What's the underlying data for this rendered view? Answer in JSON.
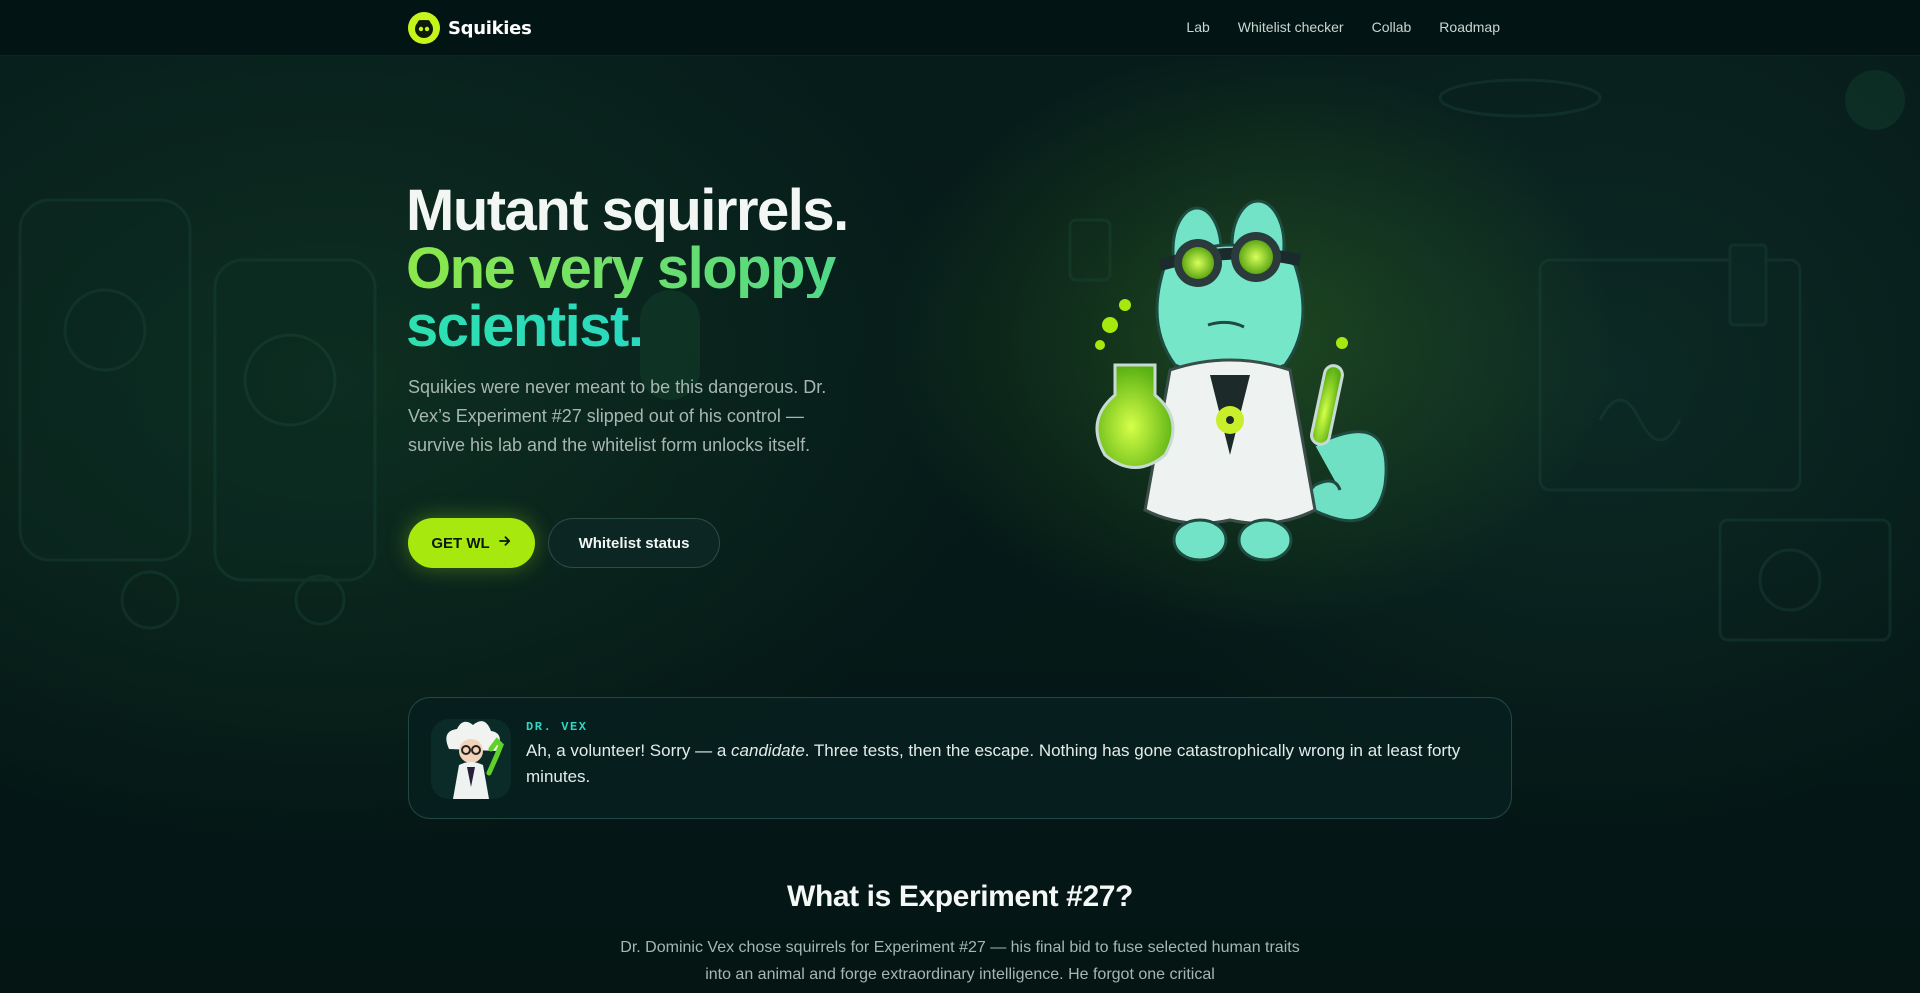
{
  "nav": {
    "brand": "Squikies",
    "brand_icon": "squirrel-logo-icon",
    "links": [
      "Lab",
      "Whitelist checker",
      "Collab",
      "Roadmap"
    ]
  },
  "hero": {
    "title_line1": "Mutant squirrels.",
    "title_line2": "One very sloppy",
    "title_line3": "scientist.",
    "description": "Squikies were never meant to be this dangerous. Dr. Vex’s Experiment #27 slipped out of his control — survive his lab and the whitelist form unlocks itself.",
    "primary_button": "GET WL",
    "primary_icon": "arrow-right-icon",
    "secondary_button": "Whitelist status"
  },
  "dialog": {
    "speaker": "DR. VEX",
    "text_before": "Ah, a volunteer! Sorry — a ",
    "text_emphasis": "candidate",
    "text_after": ". Three tests, then the escape. Nothing has gone catastrophically wrong in at least forty minutes."
  },
  "experiment": {
    "title": "What is Experiment #27?",
    "body": "Dr. Dominic Vex chose squirrels for Experiment #27 — his final bid to fuse selected human traits into an animal and forge extraordinary intelligence. He forgot one critical"
  },
  "colors": {
    "background": "#041716",
    "accent_lime": "#a7e80e",
    "accent_green": "#8ce84a",
    "accent_teal": "#2fd6c4",
    "text_muted": "#a7b6b1"
  }
}
